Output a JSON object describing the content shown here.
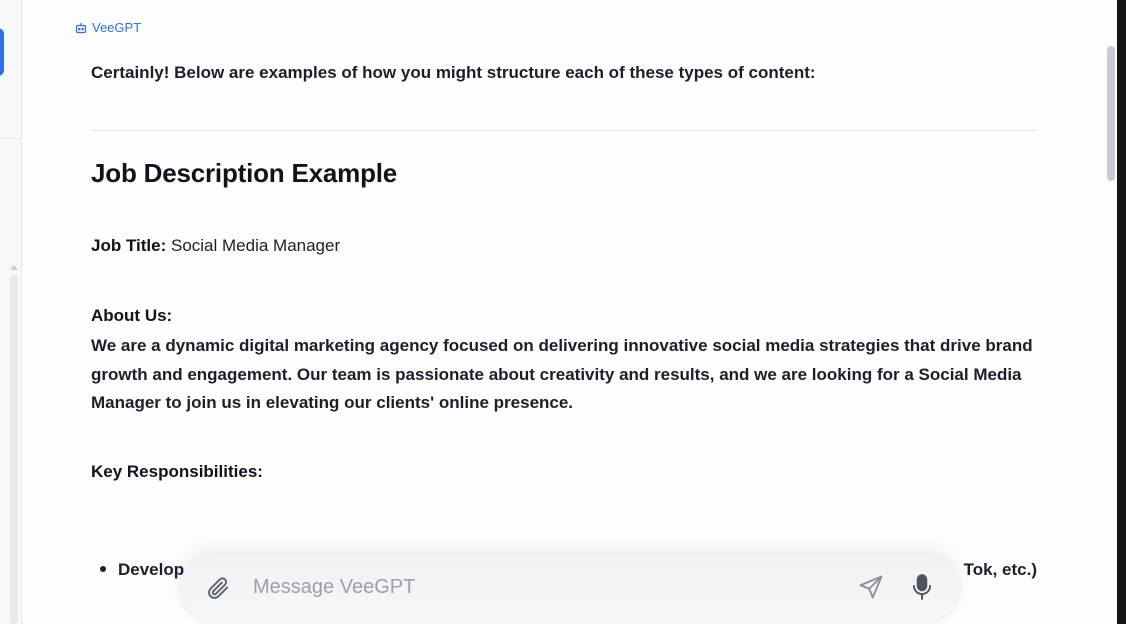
{
  "bot": {
    "name": "VeeGPT"
  },
  "message": {
    "intro": "Certainly! Below are examples of how you might structure each of these types of content:",
    "heading": "Job Description Example",
    "job_title_label": "Job Title:",
    "job_title_value": "Social Media Manager",
    "about_label": "About Us:",
    "about_text": "We are a dynamic digital marketing agency focused on delivering innovative social media strategies that drive brand growth and engagement. Our team is passionate about creativity and results, and we are looking for a Social Media Manager to join us in elevating our clients' online presence.",
    "responsibilities_label": "Key Responsibilities:",
    "bullet_start": "Develop",
    "bullet_end": "Tok, etc.)"
  },
  "composer": {
    "placeholder": "Message VeeGPT",
    "attach_icon": "paperclip-icon",
    "send_icon": "send-icon",
    "mic_icon": "microphone-icon"
  },
  "colors": {
    "accent": "#2f6fe8",
    "text": "#1c1f2a"
  }
}
